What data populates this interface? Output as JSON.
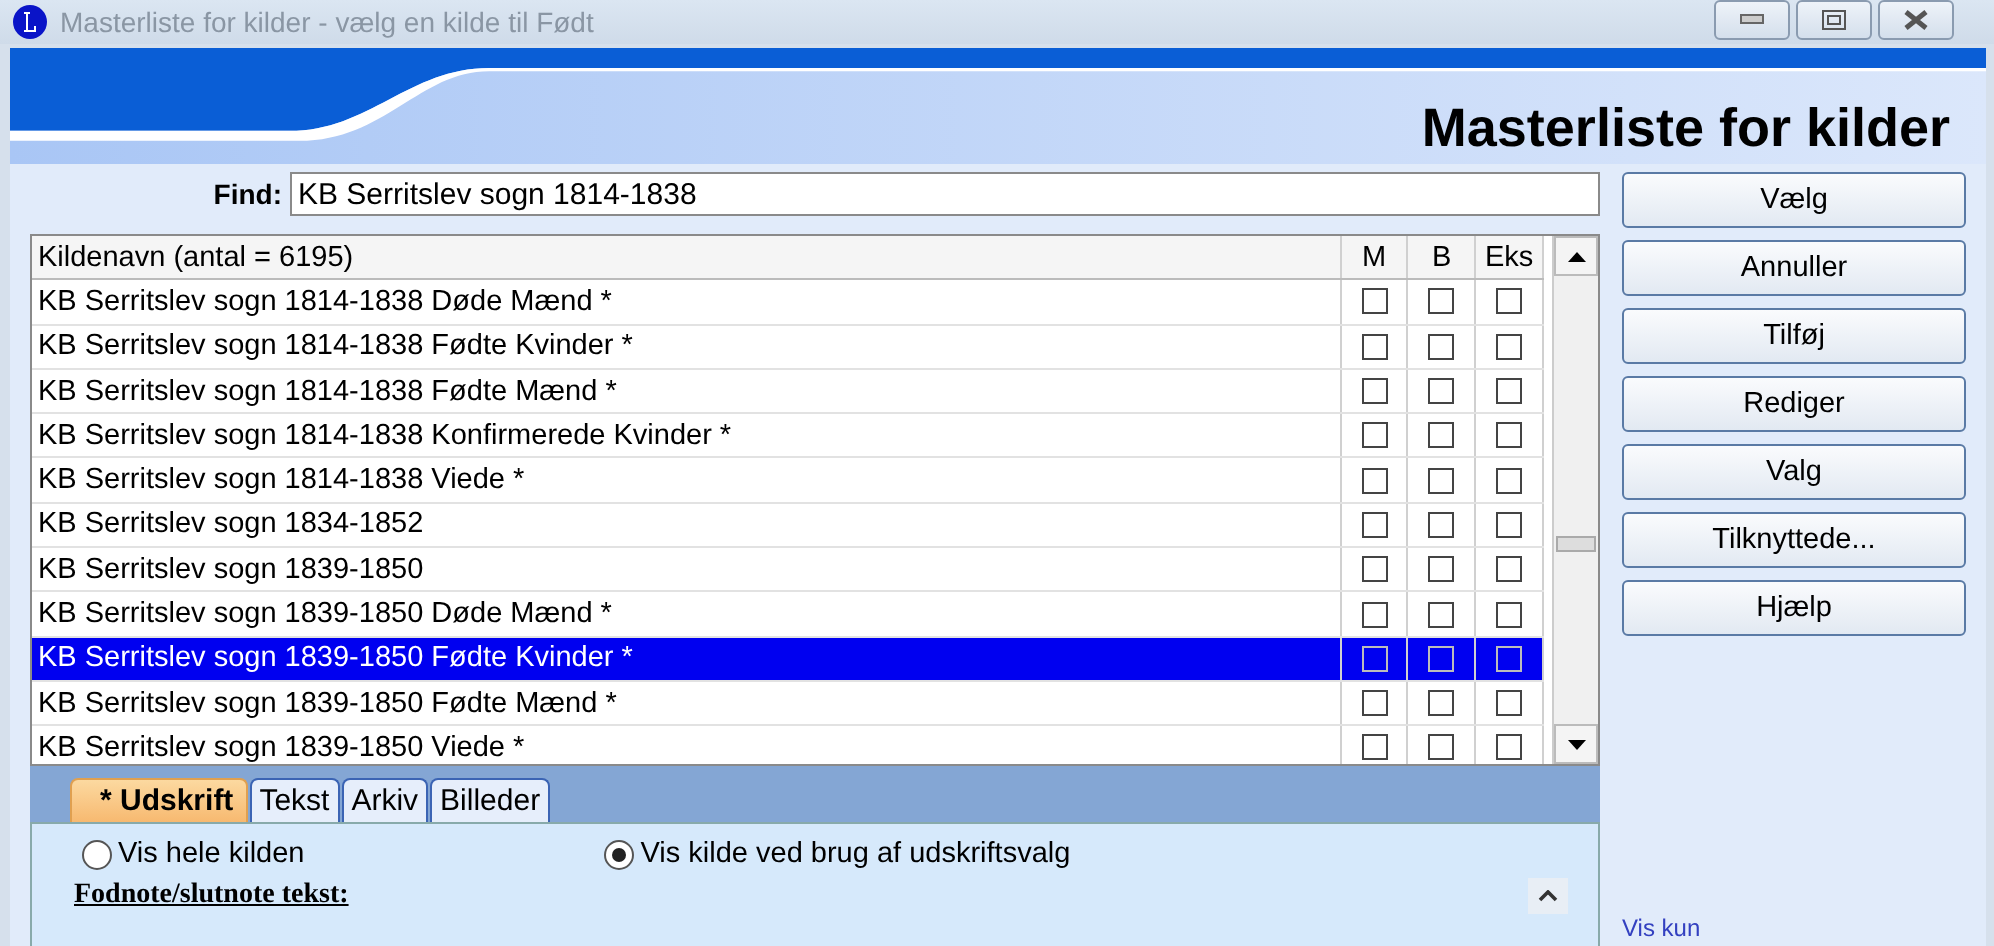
{
  "window": {
    "title": "Masterliste for kilder - vælg en kilde til Født"
  },
  "header": {
    "title": "Masterliste for kilder"
  },
  "find": {
    "label": "Find:",
    "value": "KB Serritslev sogn 1814-1838"
  },
  "table": {
    "columns": [
      "Kildenavn (antal = 6195)",
      "M",
      "B",
      "Eks"
    ],
    "rows": [
      {
        "name": "KB Serritslev sogn 1814-1838 Døde Mænd *",
        "m": false,
        "b": false,
        "eks": false,
        "selected": false
      },
      {
        "name": "KB Serritslev sogn 1814-1838 Fødte Kvinder *",
        "m": false,
        "b": false,
        "eks": false,
        "selected": false
      },
      {
        "name": "KB Serritslev sogn 1814-1838 Fødte Mænd *",
        "m": false,
        "b": false,
        "eks": false,
        "selected": false
      },
      {
        "name": "KB Serritslev sogn 1814-1838 Konfirmerede Kvinder *",
        "m": false,
        "b": false,
        "eks": false,
        "selected": false
      },
      {
        "name": "KB Serritslev sogn 1814-1838 Viede *",
        "m": false,
        "b": false,
        "eks": false,
        "selected": false
      },
      {
        "name": "KB Serritslev sogn 1834-1852",
        "m": false,
        "b": false,
        "eks": false,
        "selected": false
      },
      {
        "name": "KB Serritslev sogn 1839-1850",
        "m": false,
        "b": false,
        "eks": false,
        "selected": false
      },
      {
        "name": "KB Serritslev sogn 1839-1850 Døde Mænd *",
        "m": false,
        "b": false,
        "eks": false,
        "selected": false
      },
      {
        "name": "KB Serritslev sogn 1839-1850 Fødte Kvinder *",
        "m": false,
        "b": false,
        "eks": false,
        "selected": true
      },
      {
        "name": "KB Serritslev sogn 1839-1850 Fødte Mænd *",
        "m": false,
        "b": false,
        "eks": false,
        "selected": false
      },
      {
        "name": "KB Serritslev sogn 1839-1850 Viede *",
        "m": false,
        "b": false,
        "eks": false,
        "selected": false
      }
    ]
  },
  "buttons": [
    "Vælg",
    "Annuller",
    "Tilføj",
    "Rediger",
    "Valg",
    "Tilknyttede...",
    "Hjælp"
  ],
  "tabs": [
    {
      "label": "* Udskrift",
      "selected": true
    },
    {
      "label": "Tekst",
      "selected": false
    },
    {
      "label": "Arkiv",
      "selected": false
    },
    {
      "label": "Billeder",
      "selected": false
    }
  ],
  "options": [
    {
      "label": "Vis hele kilden",
      "selected": false
    },
    {
      "label": "Vis kilde ved brug af udskriftsvalg",
      "selected": true
    }
  ],
  "footnote_label": "Fodnote/slutnote tekst:",
  "group_label": "Vis kun"
}
